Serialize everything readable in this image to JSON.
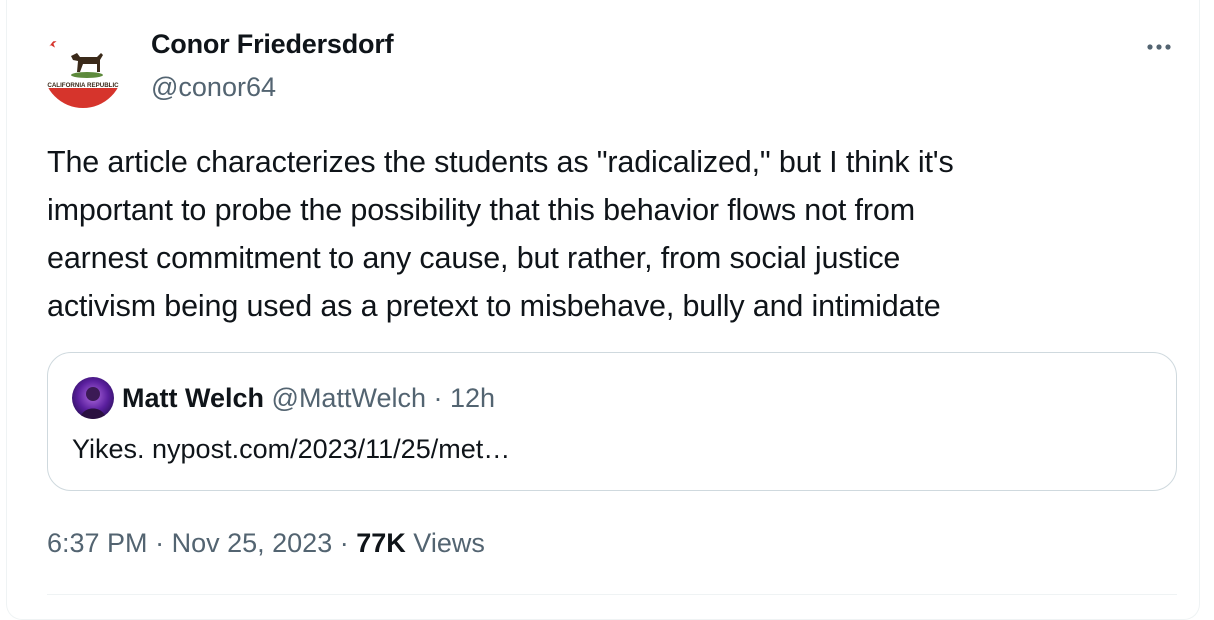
{
  "tweet": {
    "author": {
      "display_name": "Conor Friedersdorf",
      "handle": "@conor64",
      "avatar_text": "CALIFORNIA REPUBLIC"
    },
    "more_icon": "more-horizontal-icon",
    "text": "The article characterizes the students as \"radicalized,\" but I think it's\nimportant to probe the possibility that this behavior flows not from\nearnest commitment to any cause, but rather, from social justice\nactivism being used as a pretext to misbehave, bully and intimidate",
    "quote": {
      "display_name": "Matt Welch",
      "handle": "@MattWelch",
      "separator": "·",
      "time": "12h",
      "text": "Yikes. nypost.com/2023/11/25/met…"
    },
    "meta": {
      "time": "6:37 PM",
      "separator1": "·",
      "date": "Nov 25, 2023",
      "separator2": "·",
      "views_count": "77K",
      "views_label": "Views"
    }
  },
  "colors": {
    "text_primary": "#0f1419",
    "text_secondary": "#536471",
    "border": "#cfd9de",
    "flag_red": "#d6342c",
    "flag_green": "#5d8a3c"
  }
}
